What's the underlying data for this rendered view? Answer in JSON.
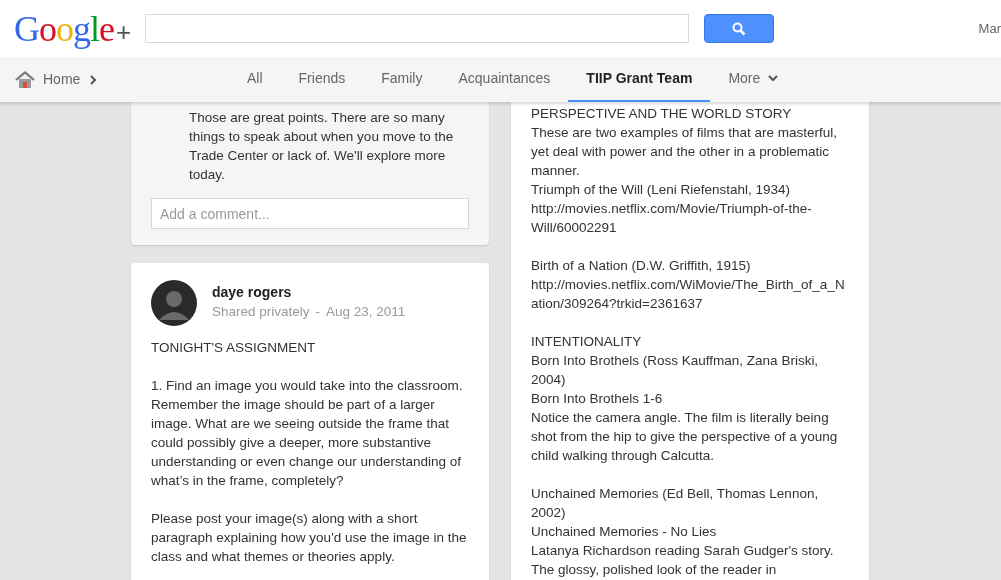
{
  "header": {
    "logo": "Google",
    "logo_plus": "+",
    "user": "Mar"
  },
  "nav": {
    "home": "Home",
    "tabs": [
      {
        "label": "All",
        "selected": false
      },
      {
        "label": "Friends",
        "selected": false
      },
      {
        "label": "Family",
        "selected": false
      },
      {
        "label": "Acquaintances",
        "selected": false
      },
      {
        "label": "TIIP Grant Team",
        "selected": true
      },
      {
        "label": "More",
        "selected": false,
        "kind": "menu"
      }
    ]
  },
  "left_column": [
    {
      "kind": "comment_card",
      "comment": "Those are great points. There are so many things to speak about when you move to the Trade Center or lack of. We'll explore more today.",
      "comment_field": {
        "placeholder": "Add a comment..."
      }
    },
    {
      "kind": "post",
      "author": "daye rogers",
      "visibility": "Shared privately",
      "separator": "-",
      "date": "Aug 23, 2011",
      "paragraphs": [
        [
          "TONIGHT'S ASSIGNMENT"
        ],
        [
          "1. Find an image you would take into the classroom. Remember the image should be part of a larger image. What are we seeing outside the frame that could possibly give a deeper, more substantive understanding or even change our understanding of what’s in the frame, completely?"
        ],
        [
          "Please post your image(s) along with a short paragraph explaining how you'd use the image in the class and what themes or theories apply."
        ]
      ]
    }
  ],
  "right_column": {
    "paragraphs": [
      [
        "PERSPECTIVE AND THE WORLD STORY",
        "These are two examples of films that are masterful, yet deal with power and the other in a problematic manner.",
        "Triumph of the Will (Leni Riefenstahl, 1934)",
        "http://movies.netflix.com/Movie/Triumph-of-the-Will/60002291"
      ],
      [
        "Birth of a Nation (D.W. Griffith, 1915)",
        "http://movies.netflix.com/WiMovie/The_Birth_of_a_Nation/309264?trkid=2361637"
      ],
      [
        "INTENTIONALITY",
        "Born Into Brothels (Ross Kauffman, Zana Briski, 2004)",
        "Born Into Brothels 1-6",
        "Notice the camera angle. The film is literally being shot from the hip to give the perspective of a young child walking through Calcutta."
      ],
      [
        "Unchained Memories (Ed Bell, Thomas Lennon, 2002)",
        "Unchained Memories - No Lies",
        "Latanya Richardson reading Sarah Gudger's story.",
        "The glossy, polished look of the reader in"
      ]
    ]
  }
}
